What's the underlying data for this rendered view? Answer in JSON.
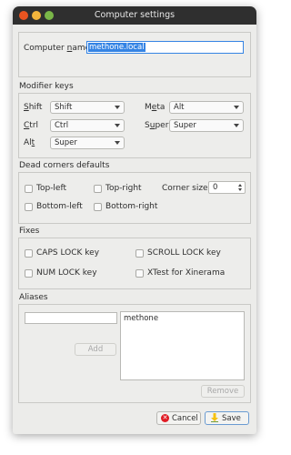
{
  "window": {
    "title": "Computer settings"
  },
  "computer_name": {
    "label_pre": "Computer ",
    "label_accel": "n",
    "label_post": "ame",
    "value": "methone.local"
  },
  "modifier_keys": {
    "title": "Modifier keys",
    "shift": {
      "accel": "S",
      "rest": "hift",
      "value": "Shift"
    },
    "ctrl": {
      "accel": "C",
      "rest": "trl",
      "value": "Ctrl"
    },
    "alt": {
      "pre": "Al",
      "accel": "t",
      "value": "Super"
    },
    "meta": {
      "pre": "M",
      "accel": "e",
      "post": "ta",
      "value": "Alt"
    },
    "super": {
      "pre": "S",
      "accel": "u",
      "post": "per",
      "value": "Super"
    }
  },
  "dead_corners": {
    "title": "Dead corners defaults",
    "top_left": "Top-left",
    "top_right": "Top-right",
    "bottom_left": "Bottom-left",
    "bottom_right": "Bottom-right",
    "corner_size_label": "Corner size",
    "corner_size_value": "0"
  },
  "fixes": {
    "title": "Fixes",
    "caps_lock": "CAPS LOCK key",
    "scroll_lock": "SCROLL LOCK key",
    "num_lock": "NUM LOCK key",
    "xtest": "XTest for Xinerama"
  },
  "aliases": {
    "title": "Aliases",
    "input_value": "",
    "add_label": "Add",
    "remove_label": "Remove",
    "items": [
      "methone"
    ]
  },
  "buttons": {
    "cancel_label": "Cancel",
    "save_label": "Save"
  },
  "colors": {
    "titlebar": "#2f2f2f",
    "selection": "#3584e4",
    "close_icon": "#e01b24",
    "save_icon": "#f5c211"
  }
}
